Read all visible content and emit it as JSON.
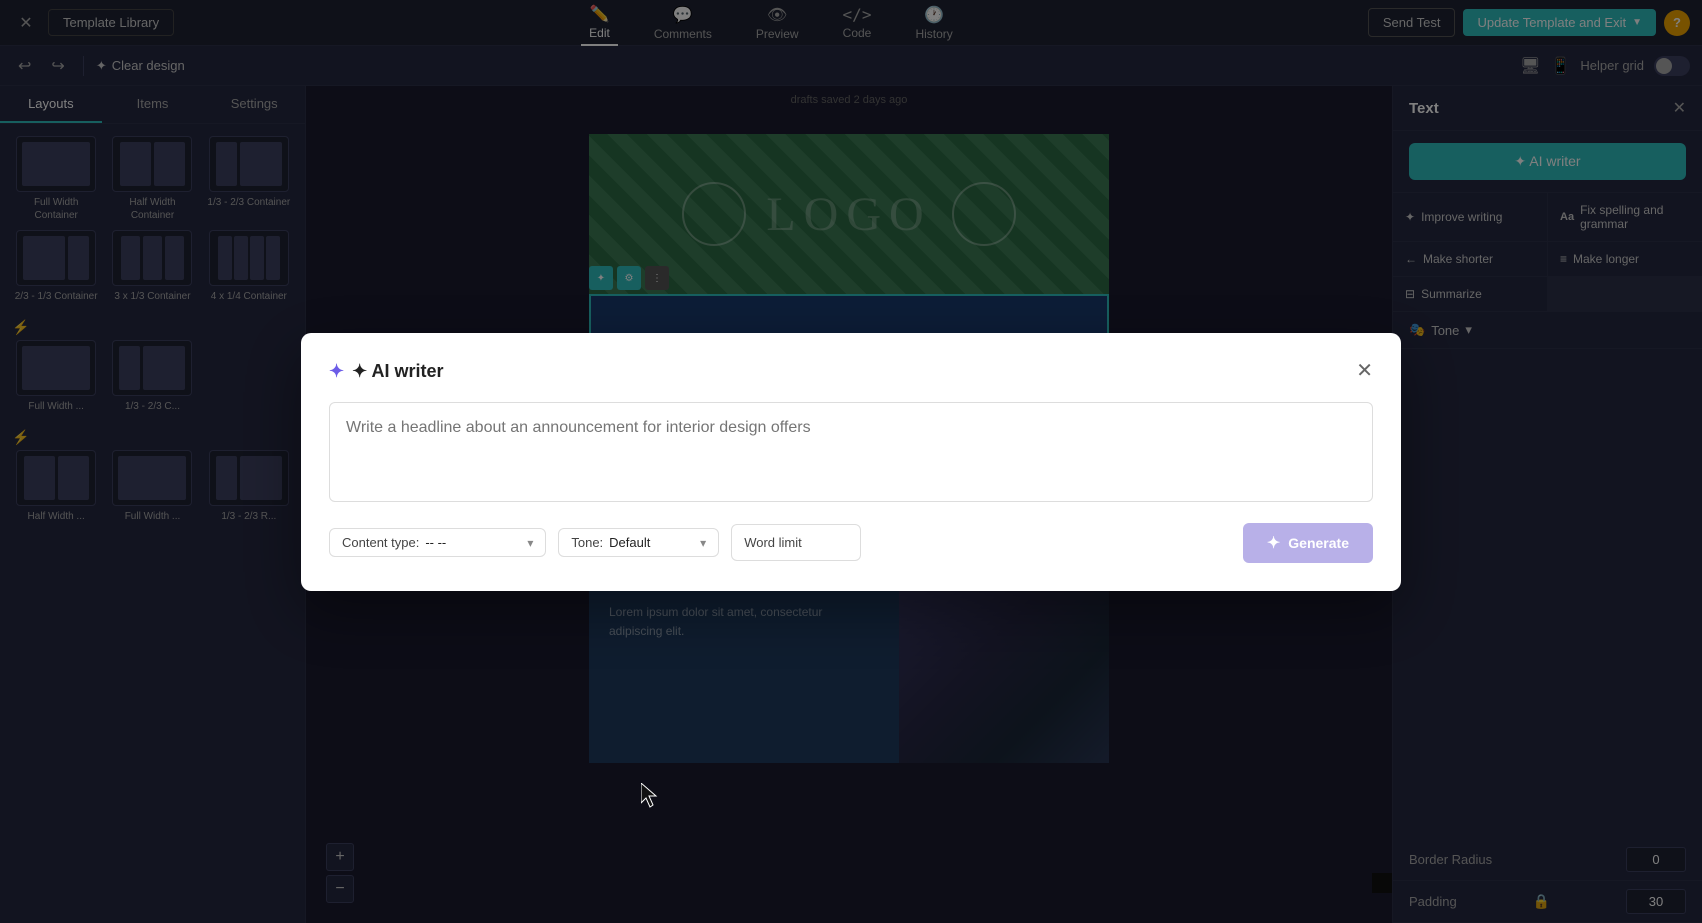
{
  "topNav": {
    "closeBtn": "✕",
    "templateLibrary": "Template Library",
    "navItems": [
      {
        "label": "Edit",
        "icon": "✏️",
        "active": true
      },
      {
        "label": "Comments",
        "icon": "💬",
        "active": false
      },
      {
        "label": "Preview",
        "icon": "👁",
        "active": false
      },
      {
        "label": "Code",
        "icon": "</>",
        "active": false
      },
      {
        "label": "History",
        "icon": "🕐",
        "active": false
      }
    ],
    "sendTest": "Send Test",
    "updateTemplate": "Update Template and Exit",
    "helpIcon": "?"
  },
  "secondaryBar": {
    "undoIcon": "↩",
    "redoIcon": "↪",
    "clearDesign": "Clear design",
    "helperGrid": "Helper grid",
    "desktopIcon": "🖥",
    "mobileIcon": "📱"
  },
  "leftPanel": {
    "tabs": [
      {
        "label": "Layouts",
        "active": true
      },
      {
        "label": "Items",
        "active": false
      },
      {
        "label": "Settings",
        "active": false
      }
    ],
    "layouts": [
      {
        "label": "Full Width Container"
      },
      {
        "label": "Half Width Container"
      },
      {
        "label": "1/3 - 2/3 Container"
      },
      {
        "label": "2/3 - 1/3 Container"
      },
      {
        "label": "3 x 1/3 Container"
      },
      {
        "label": "4 x 1/4 Container"
      },
      {
        "label": "Full Width ..."
      },
      {
        "label": "1/3 - 2/3 C..."
      },
      {
        "label": "Half Width ..."
      },
      {
        "label": "Full Width ..."
      },
      {
        "label": "1/3 - 2/3 R..."
      }
    ]
  },
  "rightPanel": {
    "title": "Text",
    "aiWriterBtn": "✦ AI writer",
    "actions": [
      {
        "label": "Improve writing",
        "icon": "✦"
      },
      {
        "label": "Fix spelling and grammar",
        "icon": "Aa"
      },
      {
        "label": "Make shorter",
        "icon": "←→"
      },
      {
        "label": "Make longer",
        "icon": "↔"
      },
      {
        "label": "Summarize",
        "icon": "≡"
      }
    ],
    "tone": "Tone",
    "borderRadius": {
      "label": "Border Radius",
      "value": "0"
    },
    "padding": {
      "label": "Padding",
      "value": "30"
    }
  },
  "modal": {
    "title": "✦ AI writer",
    "titleIcon": "✦",
    "placeholder": "Write a headline about an announcement for interior design offers",
    "contentType": {
      "label": "Content type:",
      "value": "-- --"
    },
    "tone": {
      "label": "Tone:",
      "value": "Default"
    },
    "wordLimit": {
      "label": "Word limit",
      "value": "--"
    },
    "generateBtn": "Generate",
    "closeBtn": "✕"
  }
}
